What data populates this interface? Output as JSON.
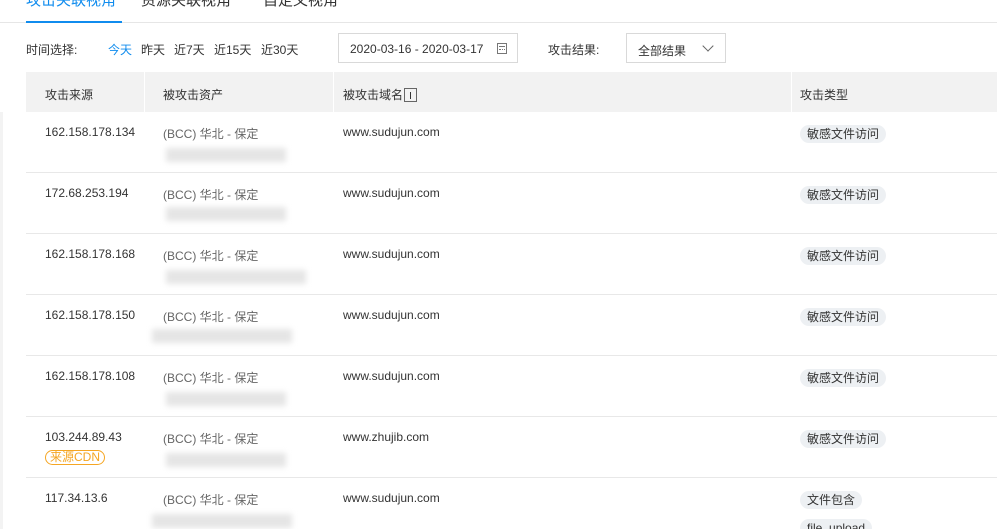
{
  "tabs": [
    {
      "label": "攻击关联视角",
      "active": true
    },
    {
      "label": "资源关联视角",
      "active": false
    },
    {
      "label": "自定义视角",
      "active": false
    }
  ],
  "filter": {
    "time_label": "时间选择:",
    "quick_ranges": [
      {
        "label": "今天",
        "active": true
      },
      {
        "label": "昨天",
        "active": false
      },
      {
        "label": "近7天",
        "active": false
      },
      {
        "label": "近15天",
        "active": false
      },
      {
        "label": "近30天",
        "active": false
      }
    ],
    "date_range": "2020-03-16 - 2020-03-17",
    "result_label": "攻击结果:",
    "result_value": "全部结果"
  },
  "table": {
    "headers": [
      "攻击来源",
      "被攻击资产",
      "被攻击域名",
      "攻击类型"
    ],
    "rows": [
      {
        "source": "162.158.178.134",
        "asset": "(BCC) 华北 - 保定",
        "domain": "www.sudujun.com",
        "types": [
          "敏感文件访问"
        ]
      },
      {
        "source": "172.68.253.194",
        "asset": "(BCC) 华北 - 保定",
        "domain": "www.sudujun.com",
        "types": [
          "敏感文件访问"
        ]
      },
      {
        "source": "162.158.178.168",
        "asset": "(BCC) 华北 - 保定",
        "domain": "www.sudujun.com",
        "types": [
          "敏感文件访问"
        ]
      },
      {
        "source": "162.158.178.150",
        "asset": "(BCC) 华北 - 保定",
        "domain": "www.sudujun.com",
        "types": [
          "敏感文件访问"
        ]
      },
      {
        "source": "162.158.178.108",
        "asset": "(BCC) 华北 - 保定",
        "domain": "www.sudujun.com",
        "types": [
          "敏感文件访问"
        ]
      },
      {
        "source": "103.244.89.43",
        "source_tag": "来源CDN",
        "asset": "(BCC) 华北 - 保定",
        "domain": "www.zhujib.com",
        "types": [
          "敏感文件访问"
        ]
      },
      {
        "source": "117.34.13.6",
        "asset": "(BCC) 华北 - 保定",
        "domain": "www.sudujun.com",
        "types": [
          "文件包含",
          "file_upload"
        ]
      }
    ]
  },
  "colors": {
    "accent": "#108cee",
    "cdn_tag": "#f5a623",
    "header_bg": "#f2f2f2",
    "badge_bg": "#edf0f3"
  }
}
